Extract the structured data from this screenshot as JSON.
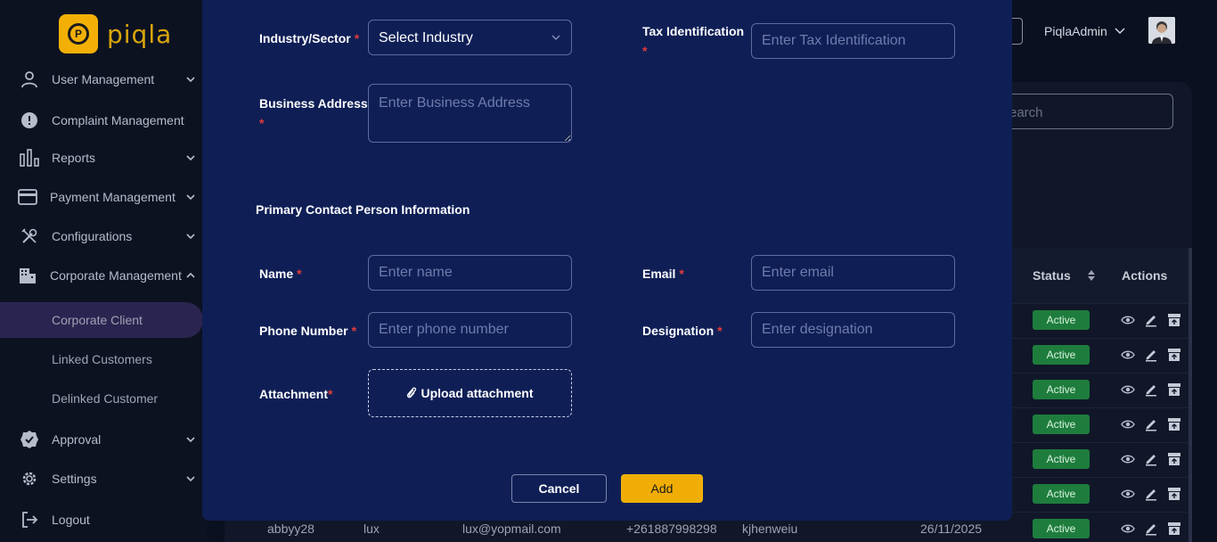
{
  "brand": {
    "name": "piqla",
    "logo_letter": "P"
  },
  "sidebar": {
    "items": [
      {
        "label": "User Management",
        "icon": "user-icon",
        "chevron": "down"
      },
      {
        "label": "Complaint Management",
        "icon": "alert-circle-icon"
      },
      {
        "label": "Reports",
        "icon": "bar-chart-icon",
        "chevron": "down"
      },
      {
        "label": "Payment Management",
        "icon": "credit-card-icon",
        "chevron": "down"
      },
      {
        "label": "Configurations",
        "icon": "tools-icon",
        "chevron": "down"
      },
      {
        "label": "Corporate Management",
        "icon": "building-icon",
        "chevron": "up"
      }
    ],
    "sub_items": [
      {
        "label": "Corporate Client",
        "active": true
      },
      {
        "label": "Linked Customers"
      },
      {
        "label": "Delinked Customer"
      }
    ],
    "bottom_items": [
      {
        "label": "Approval",
        "icon": "badge-check-icon",
        "chevron": "down"
      },
      {
        "label": "Settings",
        "icon": "gear-icon",
        "chevron": "down"
      },
      {
        "label": "Logout",
        "icon": "logout-icon"
      }
    ]
  },
  "header": {
    "user_name": "PiqlaAdmin"
  },
  "background": {
    "search_placeholder": "earch",
    "columns": {
      "status": "Status",
      "actions": "Actions"
    },
    "row_status": [
      "Active",
      "Active",
      "Active",
      "Active",
      "Active",
      "Active",
      "Active"
    ],
    "last_row": {
      "username": "abbyy28",
      "name": "lux",
      "email": "lux@yopmail.com",
      "phone": "+261887998298",
      "designation": "kjhenweiu",
      "date": "26/11/2025"
    }
  },
  "modal": {
    "industry": {
      "label": "Industry/Sector",
      "value": "Select Industry"
    },
    "tax": {
      "label": "Tax Identification",
      "placeholder": "Enter Tax Identification"
    },
    "address": {
      "label": "Business Address",
      "placeholder": "Enter Business Address"
    },
    "section_title": "Primary Contact Person Information",
    "name": {
      "label": "Name",
      "placeholder": "Enter name"
    },
    "email": {
      "label": "Email",
      "placeholder": "Enter email"
    },
    "phone": {
      "label": "Phone Number",
      "placeholder": "Enter phone number"
    },
    "designation": {
      "label": "Designation",
      "placeholder": "Enter designation"
    },
    "attachment": {
      "label": "Attachment",
      "button": "Upload attachment"
    },
    "required_mark": "*",
    "cancel": "Cancel",
    "add": "Add"
  },
  "colors": {
    "modal_bg": "#0f1f56",
    "accent": "#f0ad05",
    "required": "#e23b3b",
    "active_badge": "#1e7d3d"
  }
}
